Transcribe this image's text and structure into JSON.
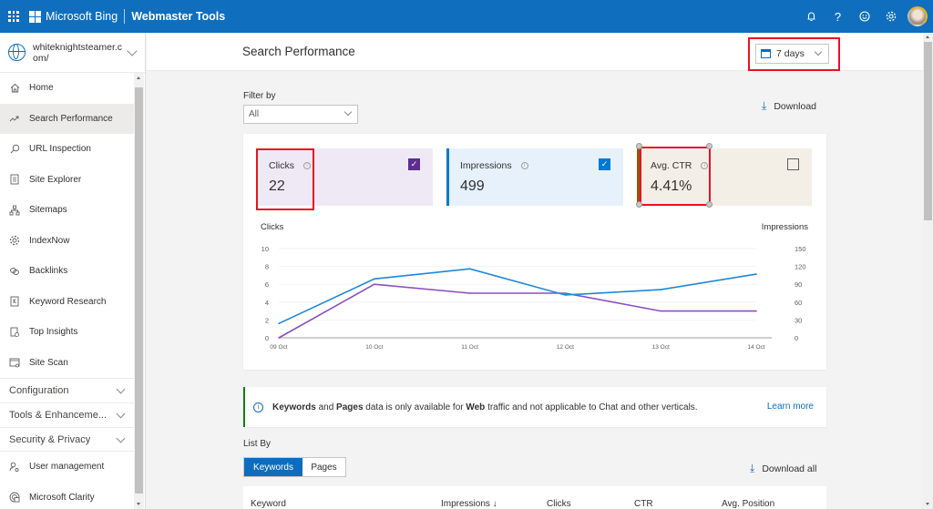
{
  "topbar": {
    "brand": "Microsoft Bing",
    "product": "Webmaster Tools",
    "icons": [
      "notification-bell-icon",
      "help-icon",
      "feedback-smiley-icon",
      "settings-gear-icon",
      "user-avatar"
    ]
  },
  "sidebar": {
    "site": "whiteknightsteamer.com/",
    "items": [
      {
        "label": "Home",
        "icon": "home-icon"
      },
      {
        "label": "Search Performance",
        "icon": "trend-icon",
        "active": true
      },
      {
        "label": "URL Inspection",
        "icon": "search-icon"
      },
      {
        "label": "Site Explorer",
        "icon": "document-list-icon"
      },
      {
        "label": "Sitemaps",
        "icon": "sitemap-icon"
      },
      {
        "label": "IndexNow",
        "icon": "gear-icon"
      },
      {
        "label": "Backlinks",
        "icon": "link-icon"
      },
      {
        "label": "Keyword Research",
        "icon": "keyword-icon"
      },
      {
        "label": "Top Insights",
        "icon": "insights-icon"
      },
      {
        "label": "Site Scan",
        "icon": "site-scan-icon"
      }
    ],
    "groups": [
      {
        "label": "Configuration"
      },
      {
        "label": "Tools & Enhanceme..."
      },
      {
        "label": "Security & Privacy"
      }
    ],
    "bottom_items": [
      {
        "label": "User management",
        "icon": "user-management-icon"
      },
      {
        "label": "Microsoft Clarity",
        "icon": "clarity-icon"
      }
    ]
  },
  "header": {
    "title": "Search Performance",
    "date_range": "7 days"
  },
  "filter": {
    "label": "Filter by",
    "value": "All"
  },
  "download_label": "Download",
  "metrics": {
    "clicks": {
      "label": "Clicks",
      "value": "22",
      "checked": true,
      "color": "#5c2e91"
    },
    "impressions": {
      "label": "Impressions",
      "value": "499",
      "checked": true,
      "color": "#0078d4"
    },
    "ctr": {
      "label": "Avg. CTR",
      "value": "4.41%",
      "checked": false,
      "color": "#8e5a00"
    }
  },
  "chart_data": {
    "type": "line",
    "categories": [
      "09 Oct",
      "10 Oct",
      "11 Oct",
      "12 Oct",
      "13 Oct",
      "14 Oct"
    ],
    "series": [
      {
        "name": "Clicks",
        "axis": "left",
        "color": "#8a4fbf",
        "values": [
          0,
          6,
          5,
          5,
          3,
          3
        ]
      },
      {
        "name": "Impressions",
        "axis": "right",
        "color": "#1e88d8",
        "values": [
          24,
          99,
          116,
          72,
          81,
          107
        ]
      }
    ],
    "ylabel_left": "Clicks",
    "ylabel_right": "Impressions",
    "ylim_left": [
      0,
      10
    ],
    "ylim_right": [
      0,
      150
    ],
    "yticks_left": [
      "0",
      "2",
      "4",
      "6",
      "8",
      "10"
    ],
    "yticks_right": [
      "0",
      "30",
      "60",
      "90",
      "120",
      "150"
    ],
    "grid": true
  },
  "notice": {
    "b1": "Keywords",
    "t1": " and ",
    "b2": "Pages",
    "t2": " data is only available for ",
    "b3": "Web",
    "t3": " traffic and not applicable to Chat and other verticals.",
    "link": "Learn more"
  },
  "list": {
    "label": "List By",
    "tabs": [
      "Keywords",
      "Pages"
    ],
    "download_all": "Download all",
    "columns": [
      "Keyword",
      "Impressions ↓",
      "Clicks",
      "CTR",
      "Avg. Position"
    ]
  }
}
